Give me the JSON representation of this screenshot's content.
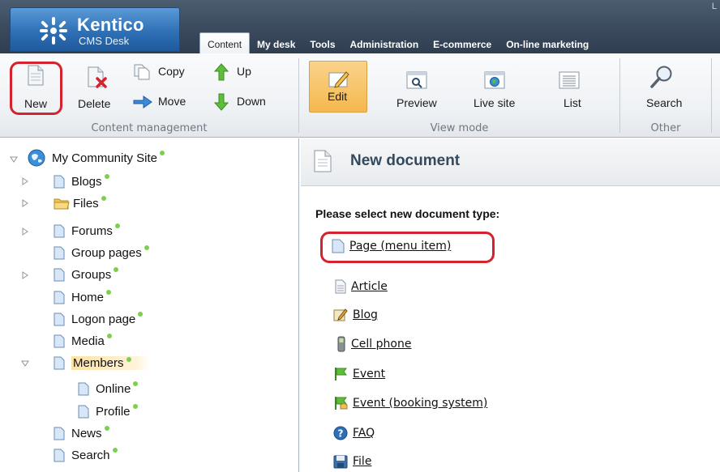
{
  "header": {
    "logo_name": "Kentico",
    "logo_sub": "CMS Desk",
    "tabs": [
      "Content",
      "My desk",
      "Tools",
      "Administration",
      "E-commerce",
      "On-line marketing"
    ],
    "active_tab": "Content",
    "corner_letter": "L"
  },
  "ribbon": {
    "groups": {
      "content_management": "Content management",
      "view_mode": "View mode",
      "other": "Other"
    },
    "buttons": {
      "new": "New",
      "delete": "Delete",
      "copy": "Copy",
      "move": "Move",
      "up": "Up",
      "down": "Down",
      "edit": "Edit",
      "preview": "Preview",
      "live_site": "Live site",
      "list": "List",
      "search": "Search"
    },
    "active_view": "Edit"
  },
  "tree": {
    "root": "My Community Site",
    "items": [
      {
        "label": "Blogs",
        "expandable": true,
        "icon": "document-icon"
      },
      {
        "label": "Files",
        "expandable": true,
        "icon": "folder-icon"
      },
      {
        "label": "Forums",
        "expandable": true,
        "icon": "document-icon"
      },
      {
        "label": "Group pages",
        "expandable": false,
        "icon": "document-icon"
      },
      {
        "label": "Groups",
        "expandable": true,
        "icon": "document-icon"
      },
      {
        "label": "Home",
        "expandable": false,
        "icon": "document-icon"
      },
      {
        "label": "Logon page",
        "expandable": false,
        "icon": "document-icon"
      },
      {
        "label": "Media",
        "expandable": false,
        "icon": "document-icon"
      },
      {
        "label": "Members",
        "expandable": true,
        "expanded": true,
        "selected": true,
        "icon": "document-icon"
      },
      {
        "label": "Online",
        "expandable": false,
        "icon": "document-icon",
        "child": true
      },
      {
        "label": "Profile",
        "expandable": false,
        "icon": "document-icon",
        "child": true
      },
      {
        "label": "News",
        "expandable": false,
        "icon": "document-icon"
      },
      {
        "label": "Search",
        "expandable": false,
        "icon": "document-icon"
      }
    ],
    "status_color": "#7dcf4e"
  },
  "main": {
    "title": "New document",
    "prompt": "Please select new document type:",
    "doc_types": [
      {
        "label": "Page (menu item)",
        "icon": "page-icon"
      },
      {
        "label": "Article",
        "icon": "article-icon"
      },
      {
        "label": "Blog",
        "icon": "blog-icon"
      },
      {
        "label": "Cell phone",
        "icon": "cell-phone-icon"
      },
      {
        "label": "Event",
        "icon": "flag-icon"
      },
      {
        "label": "Event (booking system)",
        "icon": "flag-booking-icon"
      },
      {
        "label": "FAQ",
        "icon": "question-icon"
      },
      {
        "label": "File",
        "icon": "file-icon"
      }
    ]
  },
  "colors": {
    "header": "#3a4a5c",
    "logo": "#2f70b6",
    "highlight_ring": "#d4232f",
    "edit_active": "#f4b84e"
  }
}
